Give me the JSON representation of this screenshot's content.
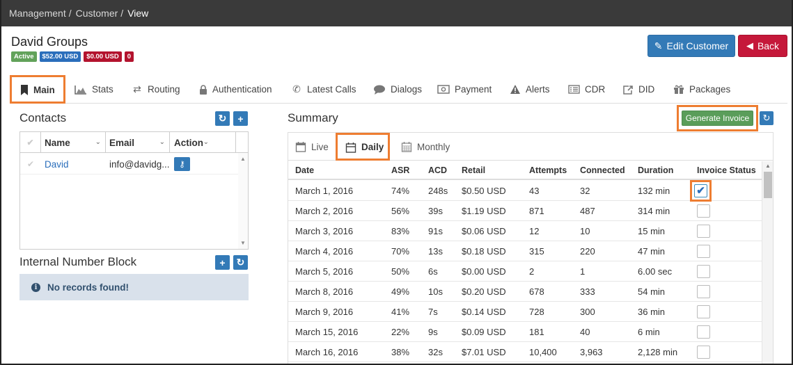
{
  "breadcrumb": [
    "Management",
    "Customer",
    "View"
  ],
  "customer": {
    "name": "David Groups",
    "badges": [
      {
        "text": "Active",
        "color": "#62a25a"
      },
      {
        "text": "$52.00 USD",
        "color": "#2a6ebb"
      },
      {
        "text": "$0.00 USD",
        "color": "#b3132e"
      },
      {
        "text": "0",
        "color": "#b3132e"
      }
    ]
  },
  "header_buttons": {
    "edit": "Edit Customer",
    "back": "Back"
  },
  "tabs": [
    {
      "label": "Main",
      "icon": "bookmark-icon",
      "active": true
    },
    {
      "label": "Stats",
      "icon": "area-chart-icon"
    },
    {
      "label": "Routing",
      "icon": "random-icon"
    },
    {
      "label": "Authentication",
      "icon": "lock-icon"
    },
    {
      "label": "Latest Calls",
      "icon": "phone-icon"
    },
    {
      "label": "Dialogs",
      "icon": "comment-icon"
    },
    {
      "label": "Payment",
      "icon": "money-icon"
    },
    {
      "label": "Alerts",
      "icon": "warning-icon"
    },
    {
      "label": "CDR",
      "icon": "list-alt-icon"
    },
    {
      "label": "DID",
      "icon": "share-square-icon"
    },
    {
      "label": "Packages",
      "icon": "gift-icon"
    }
  ],
  "contacts": {
    "title": "Contacts",
    "columns": [
      "Name",
      "Email",
      "Action"
    ],
    "rows": [
      {
        "name": "David",
        "email": "info@davidg..."
      }
    ]
  },
  "number_block": {
    "title": "Internal Number Block",
    "empty_message": "No records found!"
  },
  "summary": {
    "title": "Summary",
    "generate_label": "Generate Invoice",
    "subtabs": [
      {
        "label": "Live",
        "icon": "calendar-o-icon"
      },
      {
        "label": "Daily",
        "icon": "calendar-icon",
        "active": true
      },
      {
        "label": "Monthly",
        "icon": "calendar-grid-icon"
      }
    ],
    "columns": [
      "Date",
      "ASR",
      "ACD",
      "Retail",
      "Attempts",
      "Connected",
      "Duration",
      "Invoice Status"
    ],
    "rows": [
      {
        "date": "March 1, 2016",
        "asr": "74%",
        "acd": "248s",
        "retail": "$0.50 USD",
        "attempts": "43",
        "connected": "32",
        "duration": "132 min",
        "invoiced": true
      },
      {
        "date": "March 2, 2016",
        "asr": "56%",
        "acd": "39s",
        "retail": "$1.19 USD",
        "attempts": "871",
        "connected": "487",
        "duration": "314 min",
        "invoiced": false
      },
      {
        "date": "March 3, 2016",
        "asr": "83%",
        "acd": "91s",
        "retail": "$0.06 USD",
        "attempts": "12",
        "connected": "10",
        "duration": "15 min",
        "invoiced": false
      },
      {
        "date": "March 4, 2016",
        "asr": "70%",
        "acd": "13s",
        "retail": "$0.18 USD",
        "attempts": "315",
        "connected": "220",
        "duration": "47 min",
        "invoiced": false
      },
      {
        "date": "March 5, 2016",
        "asr": "50%",
        "acd": "6s",
        "retail": "$0.00 USD",
        "attempts": "2",
        "connected": "1",
        "duration": "6.00 sec",
        "invoiced": false
      },
      {
        "date": "March 8, 2016",
        "asr": "49%",
        "acd": "10s",
        "retail": "$0.20 USD",
        "attempts": "678",
        "connected": "333",
        "duration": "54 min",
        "invoiced": false
      },
      {
        "date": "March 9, 2016",
        "asr": "41%",
        "acd": "7s",
        "retail": "$0.14 USD",
        "attempts": "728",
        "connected": "300",
        "duration": "36 min",
        "invoiced": false
      },
      {
        "date": "March 15, 2016",
        "asr": "22%",
        "acd": "9s",
        "retail": "$0.09 USD",
        "attempts": "181",
        "connected": "40",
        "duration": "6 min",
        "invoiced": false
      },
      {
        "date": "March 16, 2016",
        "asr": "38%",
        "acd": "32s",
        "retail": "$7.01 USD",
        "attempts": "10,400",
        "connected": "3,963",
        "duration": "2,128 min",
        "invoiced": false
      }
    ]
  },
  "colors": {
    "primary": "#337ab7",
    "danger": "#c5183a",
    "success": "#5a9d5a",
    "highlight": "#ee7d31",
    "topbar": "#3a3a3a"
  }
}
